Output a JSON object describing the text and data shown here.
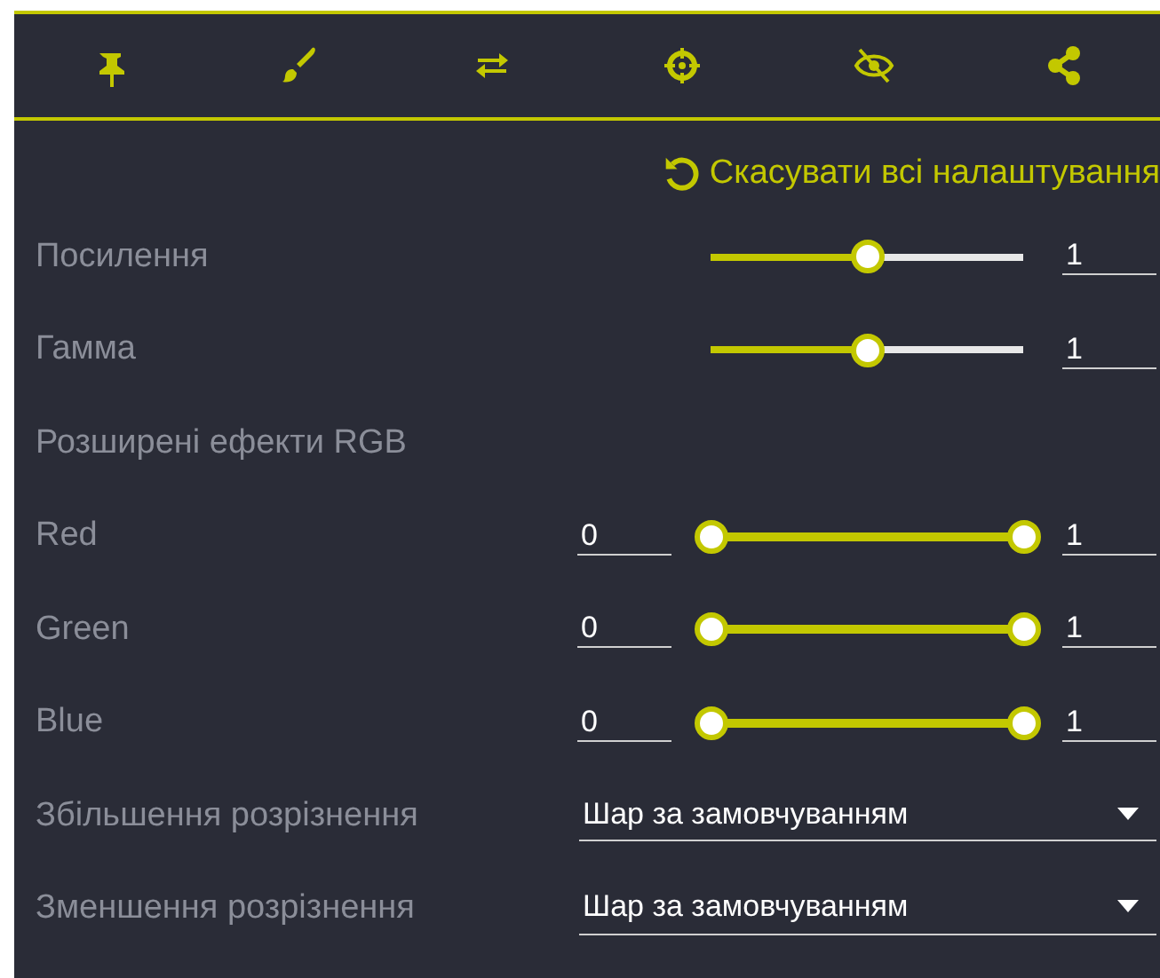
{
  "toolbar": [
    {
      "kind": "pin"
    },
    {
      "kind": "brush"
    },
    {
      "kind": "swap"
    },
    {
      "kind": "target"
    },
    {
      "kind": "hidden"
    },
    {
      "kind": "share"
    }
  ],
  "reset_link": "Скасувати всі налаштування",
  "rows": [
    {
      "kind": "slider",
      "label": "Посилення",
      "level": 0.5,
      "value": "1"
    },
    {
      "kind": "slider",
      "label": "Гамма",
      "level": 0.5,
      "value": "1"
    },
    {
      "kind": "heading",
      "label": "Розширені ефекти RGB"
    },
    {
      "kind": "range",
      "label": "Red",
      "min": "0",
      "max": "1",
      "handles": [
        {
          "level": 0
        },
        {
          "level": 1
        }
      ]
    },
    {
      "kind": "range",
      "label": "Green",
      "min": "0",
      "max": "1",
      "handles": [
        {
          "level": 0
        },
        {
          "level": 1
        }
      ]
    },
    {
      "kind": "range",
      "label": "Blue",
      "min": "0",
      "max": "1",
      "handles": [
        {
          "level": 0
        },
        {
          "level": 1
        }
      ]
    },
    {
      "kind": "select",
      "label": "Збільшення розрізнення",
      "value": "Шар за замовчуванням"
    },
    {
      "kind": "select",
      "label": "Зменшення розрізнення",
      "value": "Шар за замовчуванням"
    }
  ]
}
